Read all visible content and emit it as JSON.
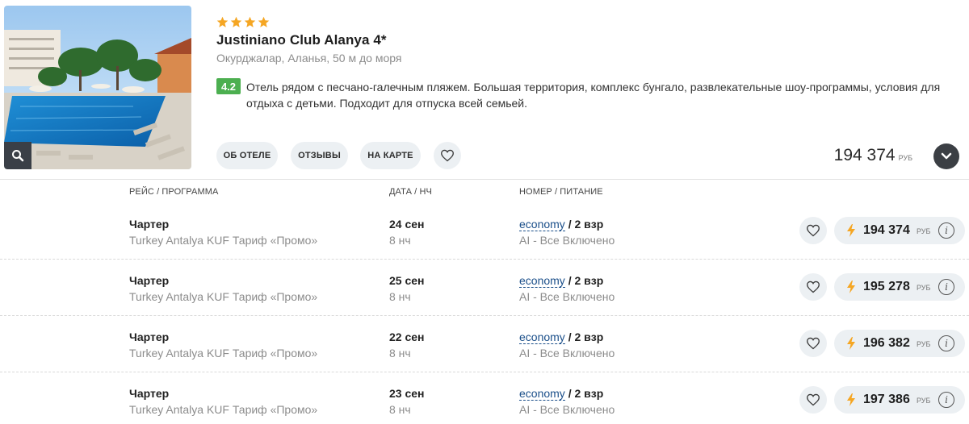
{
  "hotel": {
    "stars": 4,
    "name": "Justiniano Club Alanya 4*",
    "location": "Окурджалар, Аланья, 50 м до моря",
    "rating": "4.2",
    "description": "Отель рядом с песчано-галечным пляжем. Большая территория, комплекс бунгало, развлекательные шоу-программы, условия для отдыха с детьми. Подходит для отпуска всей семьей.",
    "star_color": "#f5a623",
    "rating_color": "#4caf50"
  },
  "actions": {
    "about": "ОБ ОТЕЛЕ",
    "reviews": "ОТЗЫВЫ",
    "map": "НА КАРТЕ"
  },
  "top_price": {
    "value": "194 374",
    "currency": "РУБ"
  },
  "columns": {
    "flight": "РЕЙС / ПРОГРАММА",
    "date": "ДАТА / НЧ",
    "room": "НОМЕР / ПИТАНИЕ"
  },
  "offers": [
    {
      "flight": "Чартер",
      "program": "Turkey Antalya KUF Тариф «Промо»",
      "date": "24 сен",
      "nights": "8 нч",
      "room_type": "economy",
      "occupancy": " / 2 взр",
      "meal": "AI - Все Включено",
      "price": "194 374",
      "currency": "РУБ"
    },
    {
      "flight": "Чартер",
      "program": "Turkey Antalya KUF Тариф «Промо»",
      "date": "25 сен",
      "nights": "8 нч",
      "room_type": "economy",
      "occupancy": " / 2 взр",
      "meal": "AI - Все Включено",
      "price": "195 278",
      "currency": "РУБ"
    },
    {
      "flight": "Чартер",
      "program": "Turkey Antalya KUF Тариф «Промо»",
      "date": "22 сен",
      "nights": "8 нч",
      "room_type": "economy",
      "occupancy": " / 2 взр",
      "meal": "AI - Все Включено",
      "price": "196 382",
      "currency": "РУБ"
    },
    {
      "flight": "Чартер",
      "program": "Turkey Antalya KUF Тариф «Промо»",
      "date": "23 сен",
      "nights": "8 нч",
      "room_type": "economy",
      "occupancy": " / 2 взр",
      "meal": "AI - Все Включено",
      "price": "197 386",
      "currency": "РУБ"
    }
  ],
  "icons": {
    "zoom": "magnifier-icon",
    "favorite": "heart-icon",
    "expand": "chevron-down-icon",
    "hot_price": "lightning-icon",
    "info": "info-icon"
  }
}
